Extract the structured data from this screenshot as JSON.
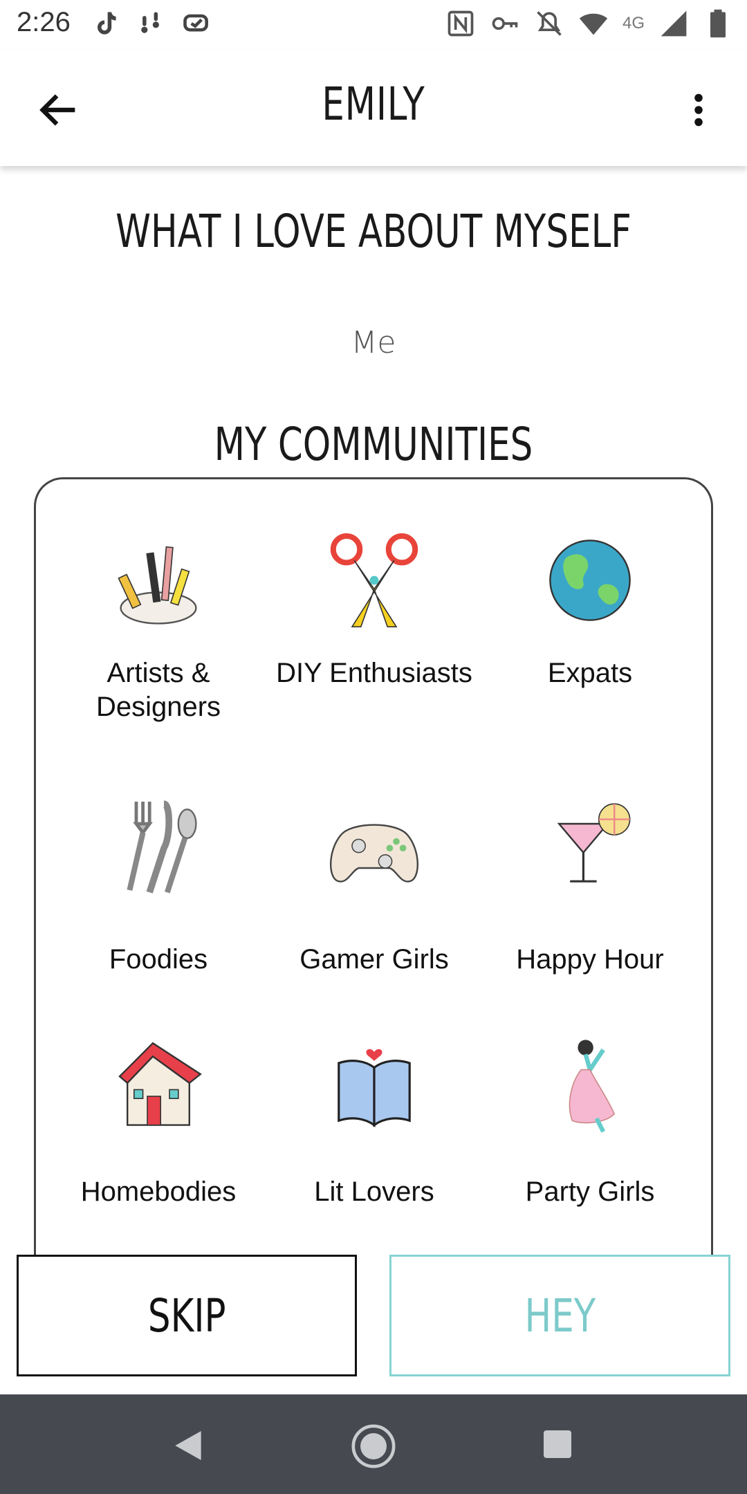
{
  "status_bar": {
    "time": "2:26",
    "network": "4G",
    "left_icons": [
      "tiktok-icon",
      "notification-icon",
      "app-icon"
    ],
    "right_icons": [
      "nfc-icon",
      "vpn-key-icon",
      "mute-icon",
      "wifi-icon",
      "signal-icon",
      "battery-icon"
    ]
  },
  "app_bar": {
    "title": "EMILY",
    "back_icon": "arrow-back-icon",
    "menu_icon": "more-vert-icon"
  },
  "about": {
    "title": "WHAT I LOVE ABOUT MYSELF",
    "text": "Me"
  },
  "communities": {
    "title": "MY COMMUNITIES",
    "items": [
      {
        "label": "Artists & Designers",
        "icon": "art-supplies-icon"
      },
      {
        "label": "DIY Enthusiasts",
        "icon": "scissors-icon"
      },
      {
        "label": "Expats",
        "icon": "globe-icon"
      },
      {
        "label": "Foodies",
        "icon": "cutlery-icon"
      },
      {
        "label": "Gamer Girls",
        "icon": "game-controller-icon"
      },
      {
        "label": "Happy Hour",
        "icon": "cocktail-icon"
      },
      {
        "label": "Homebodies",
        "icon": "house-icon"
      },
      {
        "label": "Lit Lovers",
        "icon": "book-icon"
      },
      {
        "label": "Party Girls",
        "icon": "dancer-icon"
      }
    ]
  },
  "buttons": {
    "skip": "SKIP",
    "hey": "HEY"
  },
  "colors": {
    "accent": "#7dcaca",
    "navbar": "#464a50"
  }
}
